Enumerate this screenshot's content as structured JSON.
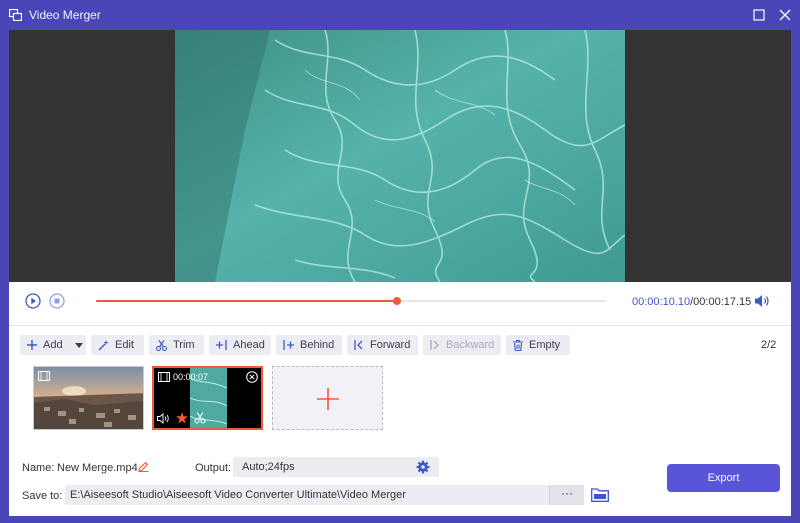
{
  "window": {
    "title": "Video Merger",
    "icons": {
      "app": "merge-icon",
      "maximize": "maximize-icon",
      "close": "close-icon"
    }
  },
  "player": {
    "current_time": "00:00:10.10",
    "total_time": "/00:00:17.15",
    "progress_fraction": 0.59,
    "icons": [
      "play-icon",
      "stop-icon",
      "volume-icon"
    ]
  },
  "toolbar": {
    "add": "Add",
    "edit": "Edit",
    "trim": "Trim",
    "ahead": "Ahead",
    "behind": "Behind",
    "forward": "Forward",
    "backward": "Backward",
    "empty": "Empty",
    "clip_counter": "2/2"
  },
  "clips": [
    {
      "label": "",
      "selected": false
    },
    {
      "label": "00:00:07",
      "selected": true
    }
  ],
  "footer": {
    "name_label": "Name:",
    "name_value": "New Merge.mp4",
    "output_label": "Output:",
    "output_value": "Auto;24fps",
    "save_label": "Save to:",
    "save_path": "E:\\Aiseesoft Studio\\Aiseesoft Video Converter Ultimate\\Video Merger",
    "browse_label": "···",
    "export_label": "Export"
  },
  "colors": {
    "accent": "#4a46b8",
    "progress": "#f05a36",
    "export_button": "#5a55d8",
    "time_current": "#3f56c8"
  }
}
